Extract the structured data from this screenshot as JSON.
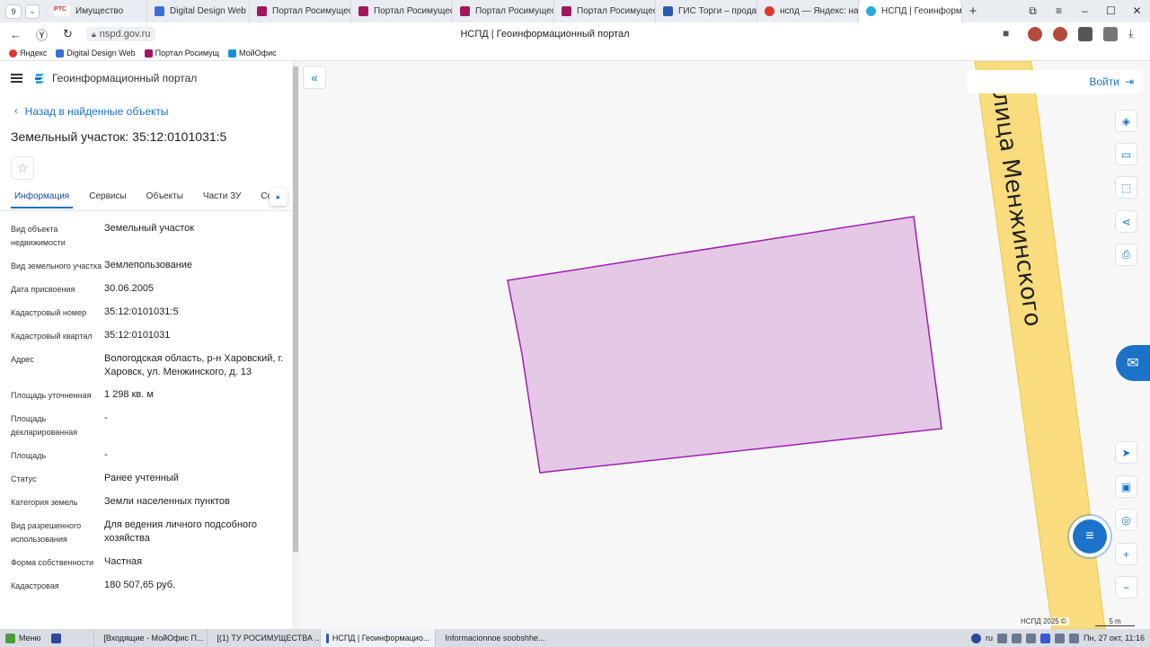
{
  "browser": {
    "tab_count": "9",
    "tabs": [
      {
        "label": "Имущество",
        "favicon_color": "#d0312d",
        "favicon_text": "РТС"
      },
      {
        "label": "Digital Design Web C",
        "favicon_color": "#3b6fd6"
      },
      {
        "label": "Портал Росимущест",
        "favicon_color": "#a3175a"
      },
      {
        "label": "Портал Росимущест",
        "favicon_color": "#a3175a"
      },
      {
        "label": "Портал Росимущест",
        "favicon_color": "#a3175a"
      },
      {
        "label": "Портал Росимущест",
        "favicon_color": "#a3175a"
      },
      {
        "label": "ГИС Торги – продаж",
        "favicon_color": "#2a5db0"
      },
      {
        "label": "нспд — Яндекс: наш",
        "favicon_color": "#e0372d"
      },
      {
        "label": "НСПД | Геоинформ",
        "favicon_color": "#29a9e0",
        "active": true
      }
    ],
    "url": "nspd.gov.ru",
    "page_title": "НСПД | Геоинформационный портал",
    "bookmarks": [
      {
        "label": "Яндекс",
        "color": "#e0372d"
      },
      {
        "label": "Digital Design Web",
        "color": "#3b6fd6"
      },
      {
        "label": "Портал Росимущ",
        "color": "#a3175a"
      },
      {
        "label": "МойОфис",
        "color": "#1a8fd8"
      }
    ]
  },
  "app": {
    "name": "Геоинформационный портал",
    "back_label": "Назад в найденные объекты",
    "object_title": "Земельный участок: 35:12:0101031:5",
    "tabs": [
      "Информация",
      "Сервисы",
      "Объекты",
      "Части ЗУ",
      "Соста"
    ],
    "properties": [
      {
        "label": "Вид объекта недвижимости",
        "value": "Земельный участок"
      },
      {
        "label": "Вид земельного участка",
        "value": "Землепользование"
      },
      {
        "label": "Дата присвоения",
        "value": "30.06.2005"
      },
      {
        "label": "Кадастровый номер",
        "value": "35:12:0101031:5"
      },
      {
        "label": "Кадастровый квартал",
        "value": "35:12:0101031"
      },
      {
        "label": "Адрес",
        "value": "Вологодская область, р-н Харовский, г. Харовск, ул. Менжинского, д. 13"
      },
      {
        "label": "Площадь уточненная",
        "value": "1 298 кв. м"
      },
      {
        "label": "Площадь декларированная",
        "value": "-"
      },
      {
        "label": "Площадь",
        "value": "-"
      },
      {
        "label": "Статус",
        "value": "Ранее учтенный"
      },
      {
        "label": "Категория земель",
        "value": "Земли населенных пунктов"
      },
      {
        "label": "Вид разрешенного использования",
        "value": "Для ведения личного подсобного хозяйства"
      },
      {
        "label": "Форма собственности",
        "value": "Частная"
      },
      {
        "label": "Кадастровая",
        "value": "180 507,65 руб."
      }
    ]
  },
  "map": {
    "login_label": "Войти",
    "street_label": "улица Менжинского",
    "attribution": "НСПД 2025 ©",
    "scale": "5 m",
    "parcel_color": "#e4c8e6",
    "parcel_stroke": "#a020b0",
    "road_color": "#f8dc7e"
  },
  "taskbar": {
    "start": "Меню",
    "items": [
      {
        "label": "[Входящие - МойОфис П...",
        "color": "#e3a21a"
      },
      {
        "label": "[(1) ТУ РОСИМУЩЕСТВА ...",
        "color": "#c43a3a"
      },
      {
        "label": "НСПД | Геоинформацио...",
        "color": "#2a5db0",
        "active": true
      },
      {
        "label": "Informacionnoe soobshhe...",
        "color": "#2a76c4"
      }
    ],
    "lang": "ru",
    "clock": "Пн, 27 окт, 11:16"
  }
}
